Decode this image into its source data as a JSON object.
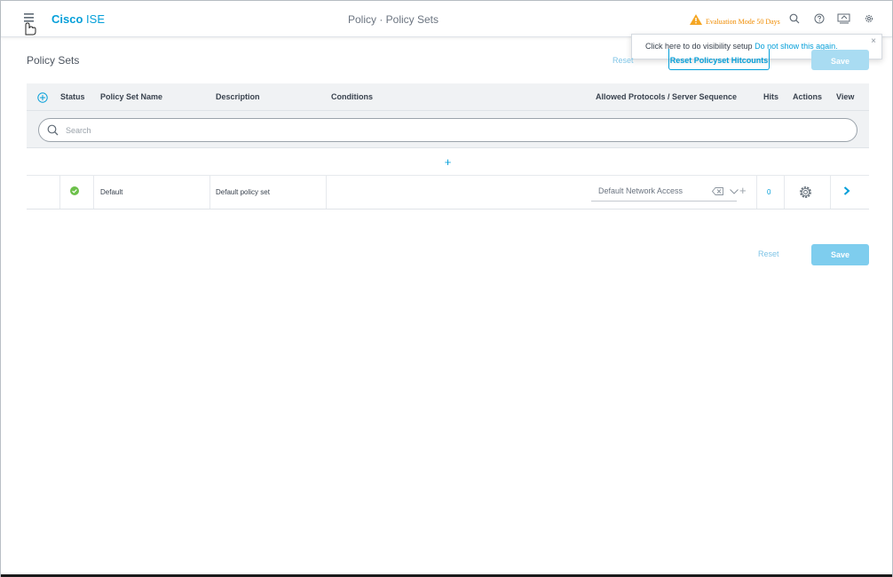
{
  "header": {
    "brand_bold": "Cisco",
    "brand_product": "ISE",
    "page_title": "Policy · Policy Sets",
    "evaluation": "Evaluation Mode 50 Days",
    "warning_color": "#f5a623",
    "icons": [
      "search-icon",
      "help-icon",
      "notifications-icon",
      "settings-icon"
    ]
  },
  "popover": {
    "text": "Click here to do visibility setup",
    "link": "Do not show this again.",
    "close": "×"
  },
  "section": {
    "title": "Policy Sets",
    "reset_label": "Reset",
    "reset_hitcounts_label": "Reset Policyset Hitcounts",
    "save_label": "Save"
  },
  "table": {
    "columns": {
      "status": "Status",
      "name": "Policy Set Name",
      "description": "Description",
      "conditions": "Conditions",
      "protocols": "Allowed Protocols / Server Sequence",
      "hits": "Hits",
      "actions": "Actions",
      "view": "View"
    },
    "search_placeholder": "Search",
    "add_row_label": "+",
    "rows": [
      {
        "status": "enabled",
        "name": "Default",
        "description": "Default policy set",
        "conditions": "",
        "protocol": "Default Network Access",
        "hits": "0"
      }
    ]
  },
  "footer": {
    "reset_label": "Reset",
    "save_label": "Save"
  },
  "colors": {
    "accent": "#049fd9",
    "status_ok": "#6cc04a",
    "save_disabled": "#7ecdee"
  }
}
